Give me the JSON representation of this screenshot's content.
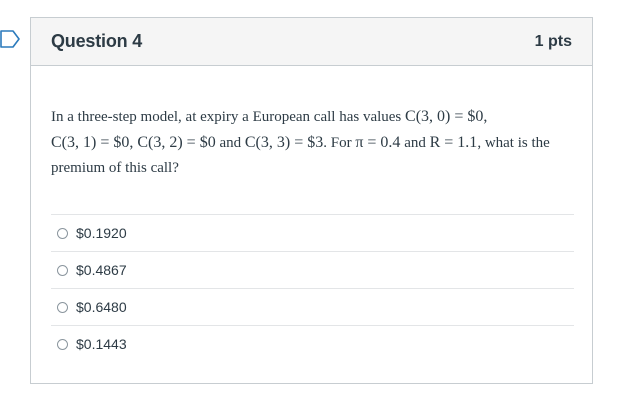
{
  "question": {
    "title": "Question 4",
    "points": "1 pts",
    "text": {
      "part1": "In a three-step model, at expiry a European call has values ",
      "m1": "C(3, 0) = $0,",
      "m2": "C(3, 1) = $0, C(3, 2) = $0",
      "part2": " and ",
      "m3": "C(3, 3) = $3",
      "part3": ". For ",
      "m4": "π = 0.4",
      "part4": " and ",
      "m5": "R = 1.1",
      "part5": ", what is the premium of this call?"
    },
    "answers": [
      {
        "label": "$0.1920",
        "selected": false
      },
      {
        "label": "$0.4867",
        "selected": false
      },
      {
        "label": "$0.6480",
        "selected": false
      },
      {
        "label": "$0.1443",
        "selected": false
      }
    ]
  },
  "colors": {
    "header_bg": "#f5f5f5",
    "border": "#c7cdd1",
    "text": "#2d3b45",
    "flag_outline": "#2b7abc"
  },
  "icons": {
    "flag": "bookmark-flag-icon",
    "radio": "radio-unchecked-icon"
  }
}
